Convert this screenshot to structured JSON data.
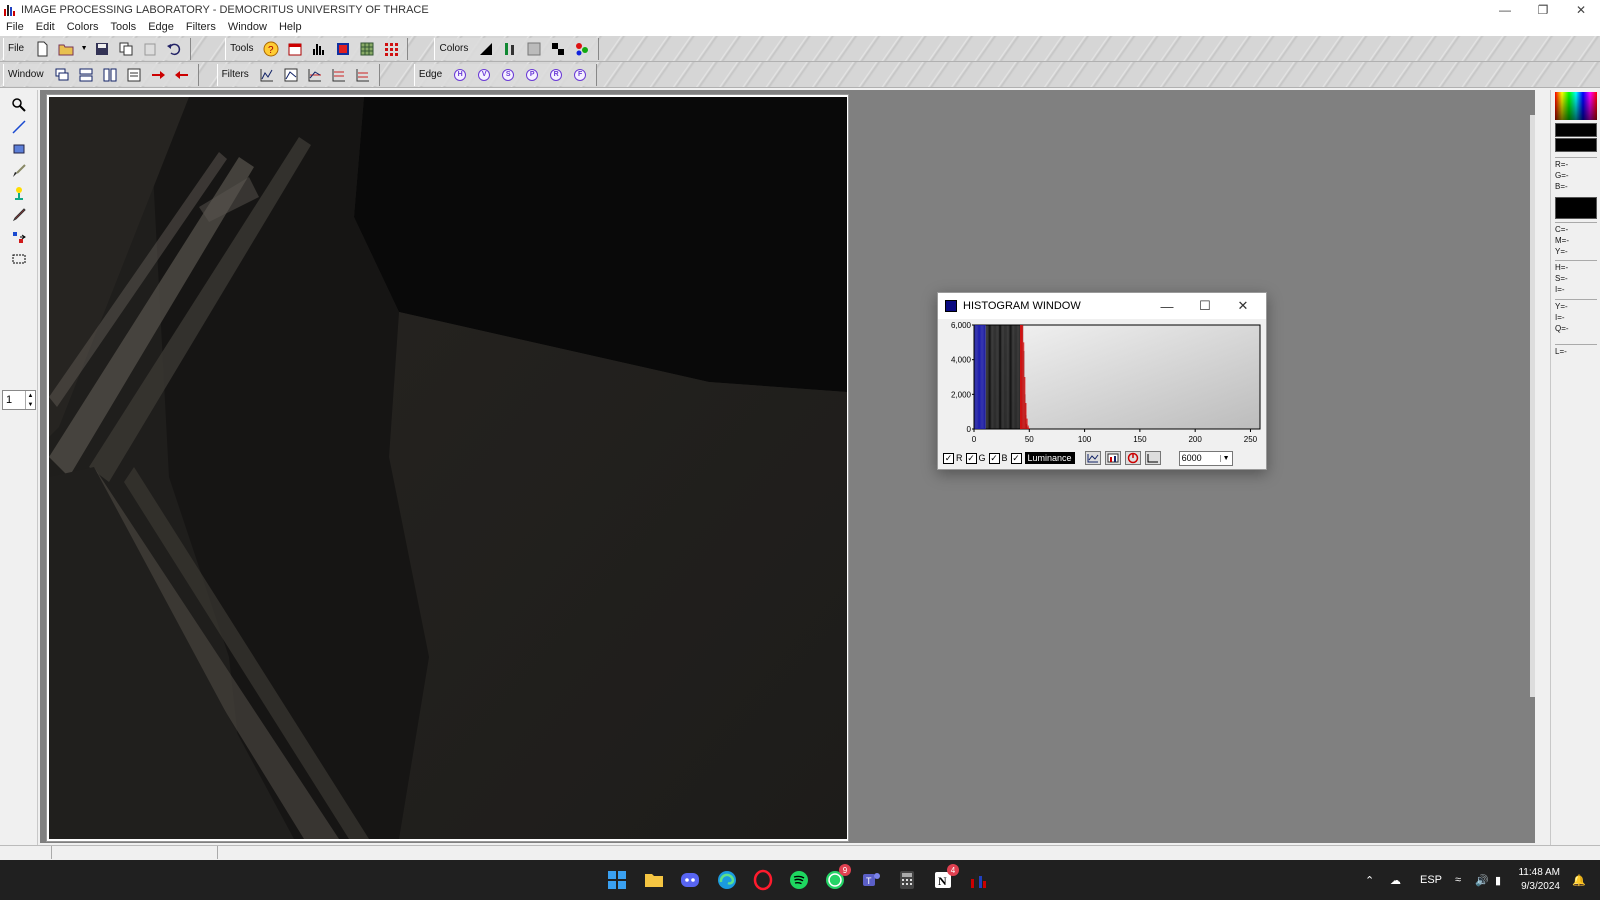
{
  "app": {
    "title": "IMAGE PROCESSING LABORATORY - DEMOCRITUS UNIVERSITY OF THRACE"
  },
  "menu": [
    "File",
    "Edit",
    "Colors",
    "Tools",
    "Edge",
    "Filters",
    "Window",
    "Help"
  ],
  "toolbar1": {
    "file_label": "File",
    "tools_label": "Tools",
    "colors_label": "Colors"
  },
  "toolbar2": {
    "window_label": "Window",
    "filters_label": "Filters",
    "edge_label": "Edge",
    "edge_buttons": [
      "H",
      "V",
      "S",
      "P",
      "R",
      "F"
    ]
  },
  "left_palette": {
    "tools": [
      "magnifier-icon",
      "line-icon",
      "rectangle-icon",
      "brush-icon",
      "color-picker-icon",
      "pencil-icon",
      "move-icon",
      "selection-icon"
    ],
    "frame_value": "1"
  },
  "histogram": {
    "title": "HISTOGRAM WINDOW",
    "y_ticks": [
      "6,000",
      "4,000",
      "2,000",
      "0"
    ],
    "x_ticks": [
      "0",
      "50",
      "100",
      "150",
      "200",
      "250"
    ],
    "channels": [
      {
        "name": "R",
        "checked": true
      },
      {
        "name": "G",
        "checked": true
      },
      {
        "name": "B",
        "checked": true
      }
    ],
    "luminance_label": "Luminance",
    "luminance_checked": true,
    "scale_value": "6000"
  },
  "chart_data": {
    "type": "bar",
    "title": "",
    "xlabel": "",
    "ylabel": "",
    "xlim": [
      0,
      255
    ],
    "ylim": [
      0,
      6000
    ],
    "grid": false,
    "x": [
      1,
      2,
      3,
      4,
      5,
      6,
      7,
      8,
      9,
      10,
      11,
      12,
      13,
      14,
      15,
      16,
      17,
      18,
      19,
      20,
      21,
      22,
      23,
      24,
      25,
      26,
      27,
      28,
      29,
      30,
      31,
      32,
      33,
      34,
      35,
      36,
      37,
      38,
      39,
      40,
      41,
      42,
      43,
      44,
      45,
      46,
      47,
      48,
      49,
      50
    ],
    "series": [
      {
        "color": "#000000",
        "values": [
          6000,
          6000,
          6000,
          6000,
          6000,
          6000,
          6000,
          6000,
          6000,
          6000,
          6000,
          6000,
          6000,
          6000,
          6000,
          6000,
          6000,
          6000,
          6000,
          6000,
          6000,
          6000,
          6000,
          6000,
          6000,
          6000,
          6000,
          6000,
          6000,
          6000,
          6000,
          6000,
          6000,
          6000,
          6000,
          6000,
          6000,
          6000,
          6000,
          6000,
          6000,
          6000,
          6000,
          6000,
          4500,
          2000,
          800,
          300,
          100,
          0
        ]
      },
      {
        "color": "#2020c0",
        "values": [
          6000,
          6000,
          6000,
          6000,
          6000,
          6000,
          6000,
          6000,
          6000,
          6000,
          0,
          0,
          0,
          0,
          0,
          0,
          0,
          0,
          0,
          0,
          0,
          0,
          0,
          0,
          0,
          0,
          0,
          0,
          0,
          0,
          0,
          0,
          0,
          0,
          0,
          0,
          0,
          0,
          0,
          0,
          0,
          0,
          0,
          0,
          0,
          0,
          0,
          0,
          0,
          0
        ]
      },
      {
        "color": "#e01010",
        "values": [
          0,
          0,
          0,
          0,
          0,
          0,
          0,
          0,
          0,
          0,
          0,
          0,
          0,
          0,
          0,
          0,
          0,
          0,
          0,
          0,
          0,
          0,
          0,
          0,
          0,
          0,
          0,
          0,
          0,
          0,
          0,
          0,
          0,
          0,
          0,
          0,
          0,
          0,
          0,
          0,
          0,
          6000,
          6000,
          6000,
          5000,
          3000,
          1500,
          600,
          200,
          50
        ]
      }
    ]
  },
  "right_panel": {
    "rgb": [
      "R=-",
      "G=-",
      "B=-"
    ],
    "cmy": [
      "C=-",
      "M=-",
      "Y=-"
    ],
    "hsi": [
      "H=-",
      "S=-",
      "I=-"
    ],
    "yiq": [
      "Y=-",
      "I=-",
      "Q=-"
    ],
    "l": [
      "L=-"
    ]
  },
  "taskbar": {
    "apps": [
      "windows-start-icon",
      "file-explorer-icon",
      "discord-icon",
      "edge-browser-icon",
      "opera-icon",
      "spotify-icon",
      "whatsapp-icon",
      "teams-icon",
      "calculator-icon",
      "notion-icon",
      "histogram-app-icon"
    ],
    "whatsapp_badge": "9",
    "notion_badge": "4",
    "language": "ESP",
    "time": "11:48 AM",
    "date": "9/3/2024"
  }
}
